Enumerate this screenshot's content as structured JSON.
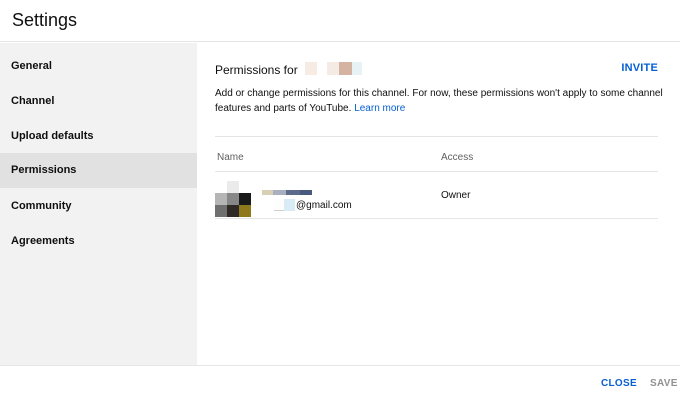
{
  "header": {
    "title": "Settings"
  },
  "sidebar": {
    "items": [
      {
        "label": "General"
      },
      {
        "label": "Channel"
      },
      {
        "label": "Upload defaults"
      },
      {
        "label": "Permissions"
      },
      {
        "label": "Community"
      },
      {
        "label": "Agreements"
      }
    ]
  },
  "main": {
    "title": "Permissions for",
    "invite_label": "INVITE",
    "description": "Add or change permissions for this channel. For now, these permissions won't apply to some channel features and parts of YouTube.",
    "learn_more": "Learn more",
    "table": {
      "columns": [
        "Name",
        "Access"
      ],
      "rows": [
        {
          "email_suffix": "@gmail.com",
          "access": "Owner"
        }
      ]
    }
  },
  "footer": {
    "close_label": "CLOSE",
    "save_label": "SAVE"
  },
  "colors": {
    "accent": "#065fd4",
    "sidebar_bg": "#f2f2f2",
    "sidebar_active": "#e1e1e1",
    "disabled": "#909090"
  }
}
